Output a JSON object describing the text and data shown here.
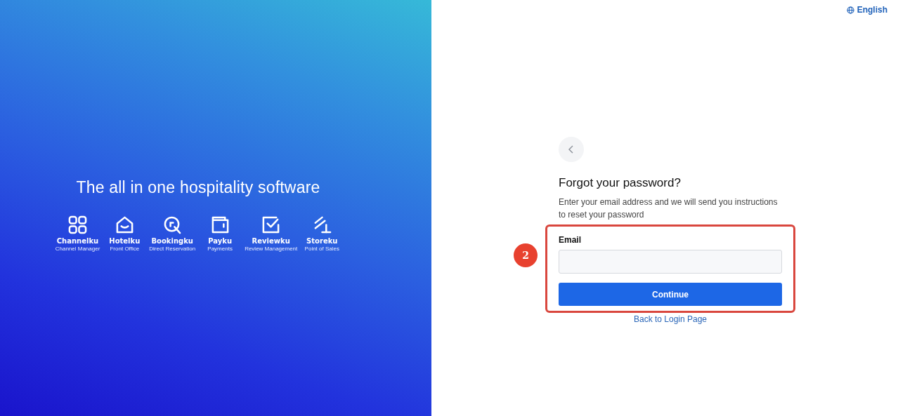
{
  "hero": {
    "headline": "The all in one hospitality software",
    "products": [
      {
        "kind": "grid",
        "name": "Channelku",
        "subtitle": "Channel Manager"
      },
      {
        "kind": "house",
        "name": "Hotelku",
        "subtitle": "Front Office"
      },
      {
        "kind": "search",
        "name": "Bookingku",
        "subtitle": "Direct Reservation"
      },
      {
        "kind": "wallet",
        "name": "Payku",
        "subtitle": "Payments"
      },
      {
        "kind": "check",
        "name": "Reviewku",
        "subtitle": "Review Management"
      },
      {
        "kind": "tool",
        "name": "Storeku",
        "subtitle": "Point of Sales"
      }
    ]
  },
  "language": {
    "label": "English"
  },
  "form": {
    "title": "Forgot your password?",
    "description": "Enter your email address and we will send you instructions to reset your password",
    "email": {
      "label": "Email"
    },
    "submit": "Continue",
    "back_link": "Back to Login Page"
  },
  "annotation": {
    "number": "2"
  }
}
